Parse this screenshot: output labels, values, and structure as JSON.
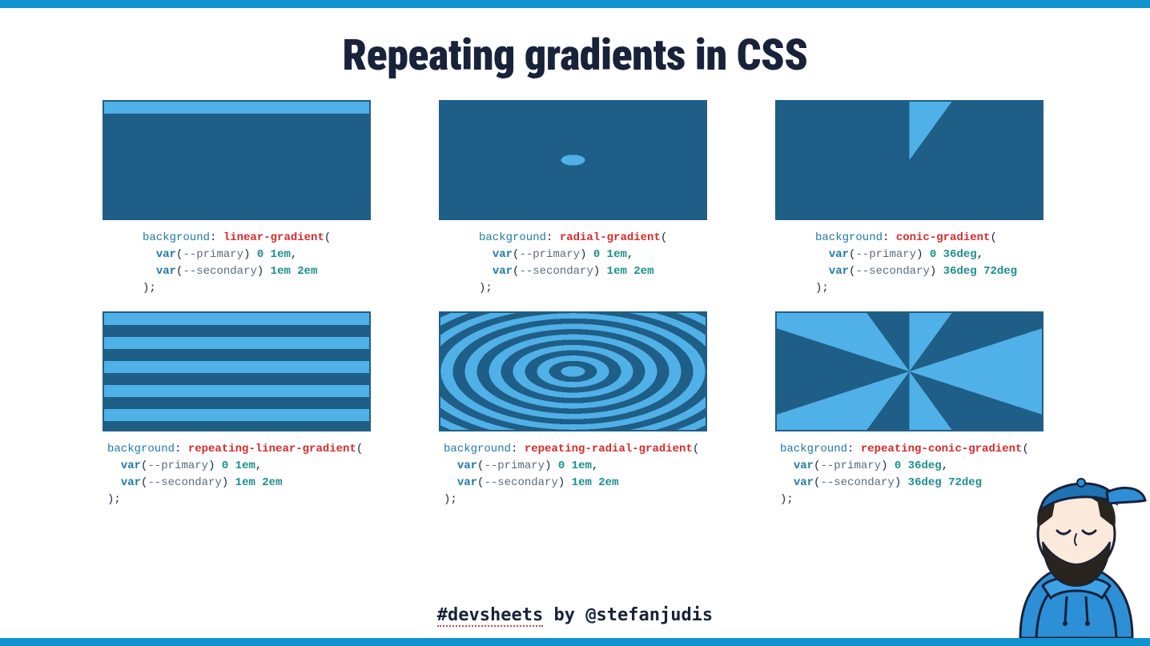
{
  "title": "Repeating gradients in CSS",
  "code": {
    "prop": "background",
    "var_fn": "var",
    "primary": "--primary",
    "secondary": "--secondary",
    "linear": {
      "fn": "linear-gradient",
      "stops_a": "0 1em",
      "stops_b": "1em 2em"
    },
    "radial": {
      "fn": "radial-gradient",
      "stops_a": "0 1em",
      "stops_b": "1em 2em"
    },
    "conic": {
      "fn": "conic-gradient",
      "stops_a": "0 36deg",
      "stops_b": "36deg 72deg"
    },
    "rlinear": {
      "fn": "repeating-linear-gradient",
      "stops_a": "0 1em",
      "stops_b": "1em 2em"
    },
    "rradial": {
      "fn": "repeating-radial-gradient",
      "stops_a": "0 1em",
      "stops_b": "1em 2em"
    },
    "rconic": {
      "fn": "repeating-conic-gradient",
      "stops_a": "0 36deg",
      "stops_b": "36deg 72deg"
    }
  },
  "footer": {
    "tag": "#devsheets",
    "by": " by ",
    "handle": "@stefanjudis"
  }
}
